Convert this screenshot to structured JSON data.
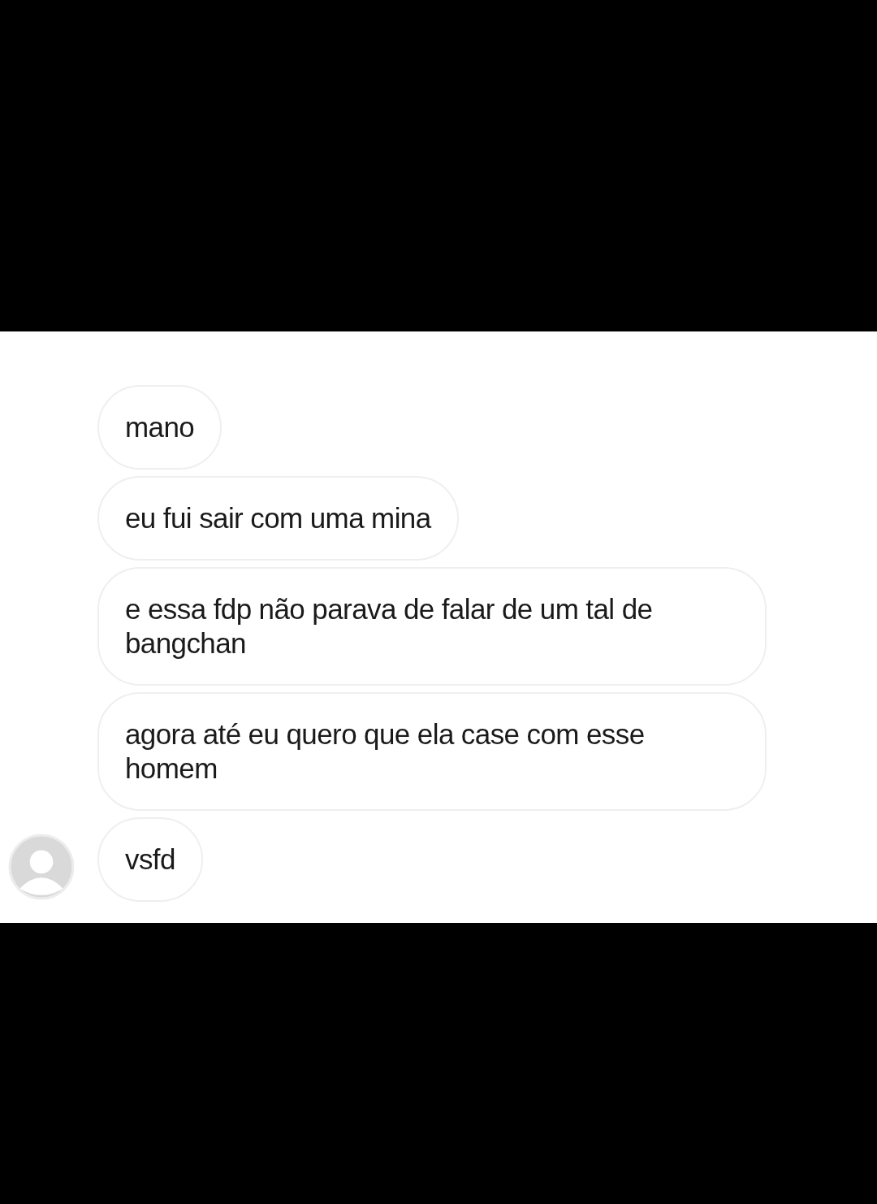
{
  "messages": [
    {
      "text": "mano",
      "avatar": false
    },
    {
      "text": "eu fui sair com uma mina",
      "avatar": false
    },
    {
      "text": "e essa fdp não parava de falar de um tal de bangchan",
      "avatar": false
    },
    {
      "text": "agora até eu quero que ela case com esse homem",
      "avatar": false
    },
    {
      "text": "vsfd",
      "avatar": true
    }
  ]
}
